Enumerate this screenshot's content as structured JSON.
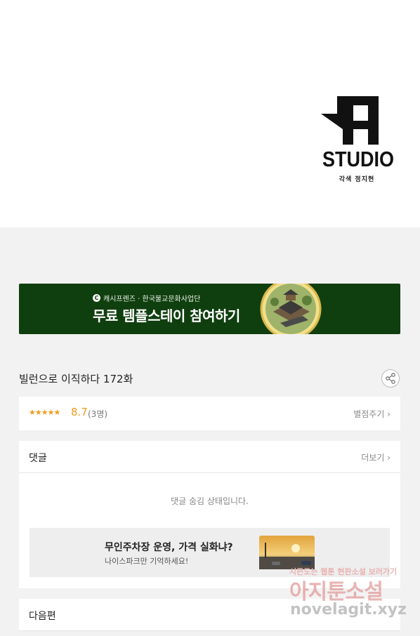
{
  "logo": {
    "name": "STUDIO",
    "credit": "각색 정지현"
  },
  "banner": {
    "sponsor": "캐시프렌즈 · 한국불교문화사업단",
    "title": "무료 템플스테이 참여하기",
    "icon": "c-icon"
  },
  "episode": {
    "title": "빌런으로 이직하다 172화",
    "share_icon": "share-icon"
  },
  "rating": {
    "stars": "★★★★★",
    "score": "8.7",
    "count": "(3명)",
    "rate_label": "별점주기 ›"
  },
  "comments": {
    "label": "댓글",
    "more_label": "더보기 ›",
    "hidden_notice": "댓글 숨김 상태입니다."
  },
  "ad": {
    "title": "무인주차장 운영, 가격 실화냐?",
    "subtitle": "나이스파크만 기억하세요!"
  },
  "next": {
    "label": "다음편"
  },
  "watermark": {
    "top": "시즌도는 웹툰 현판소설 보러가기",
    "main": "아지툰소설",
    "url": "novelagit.xyz"
  }
}
